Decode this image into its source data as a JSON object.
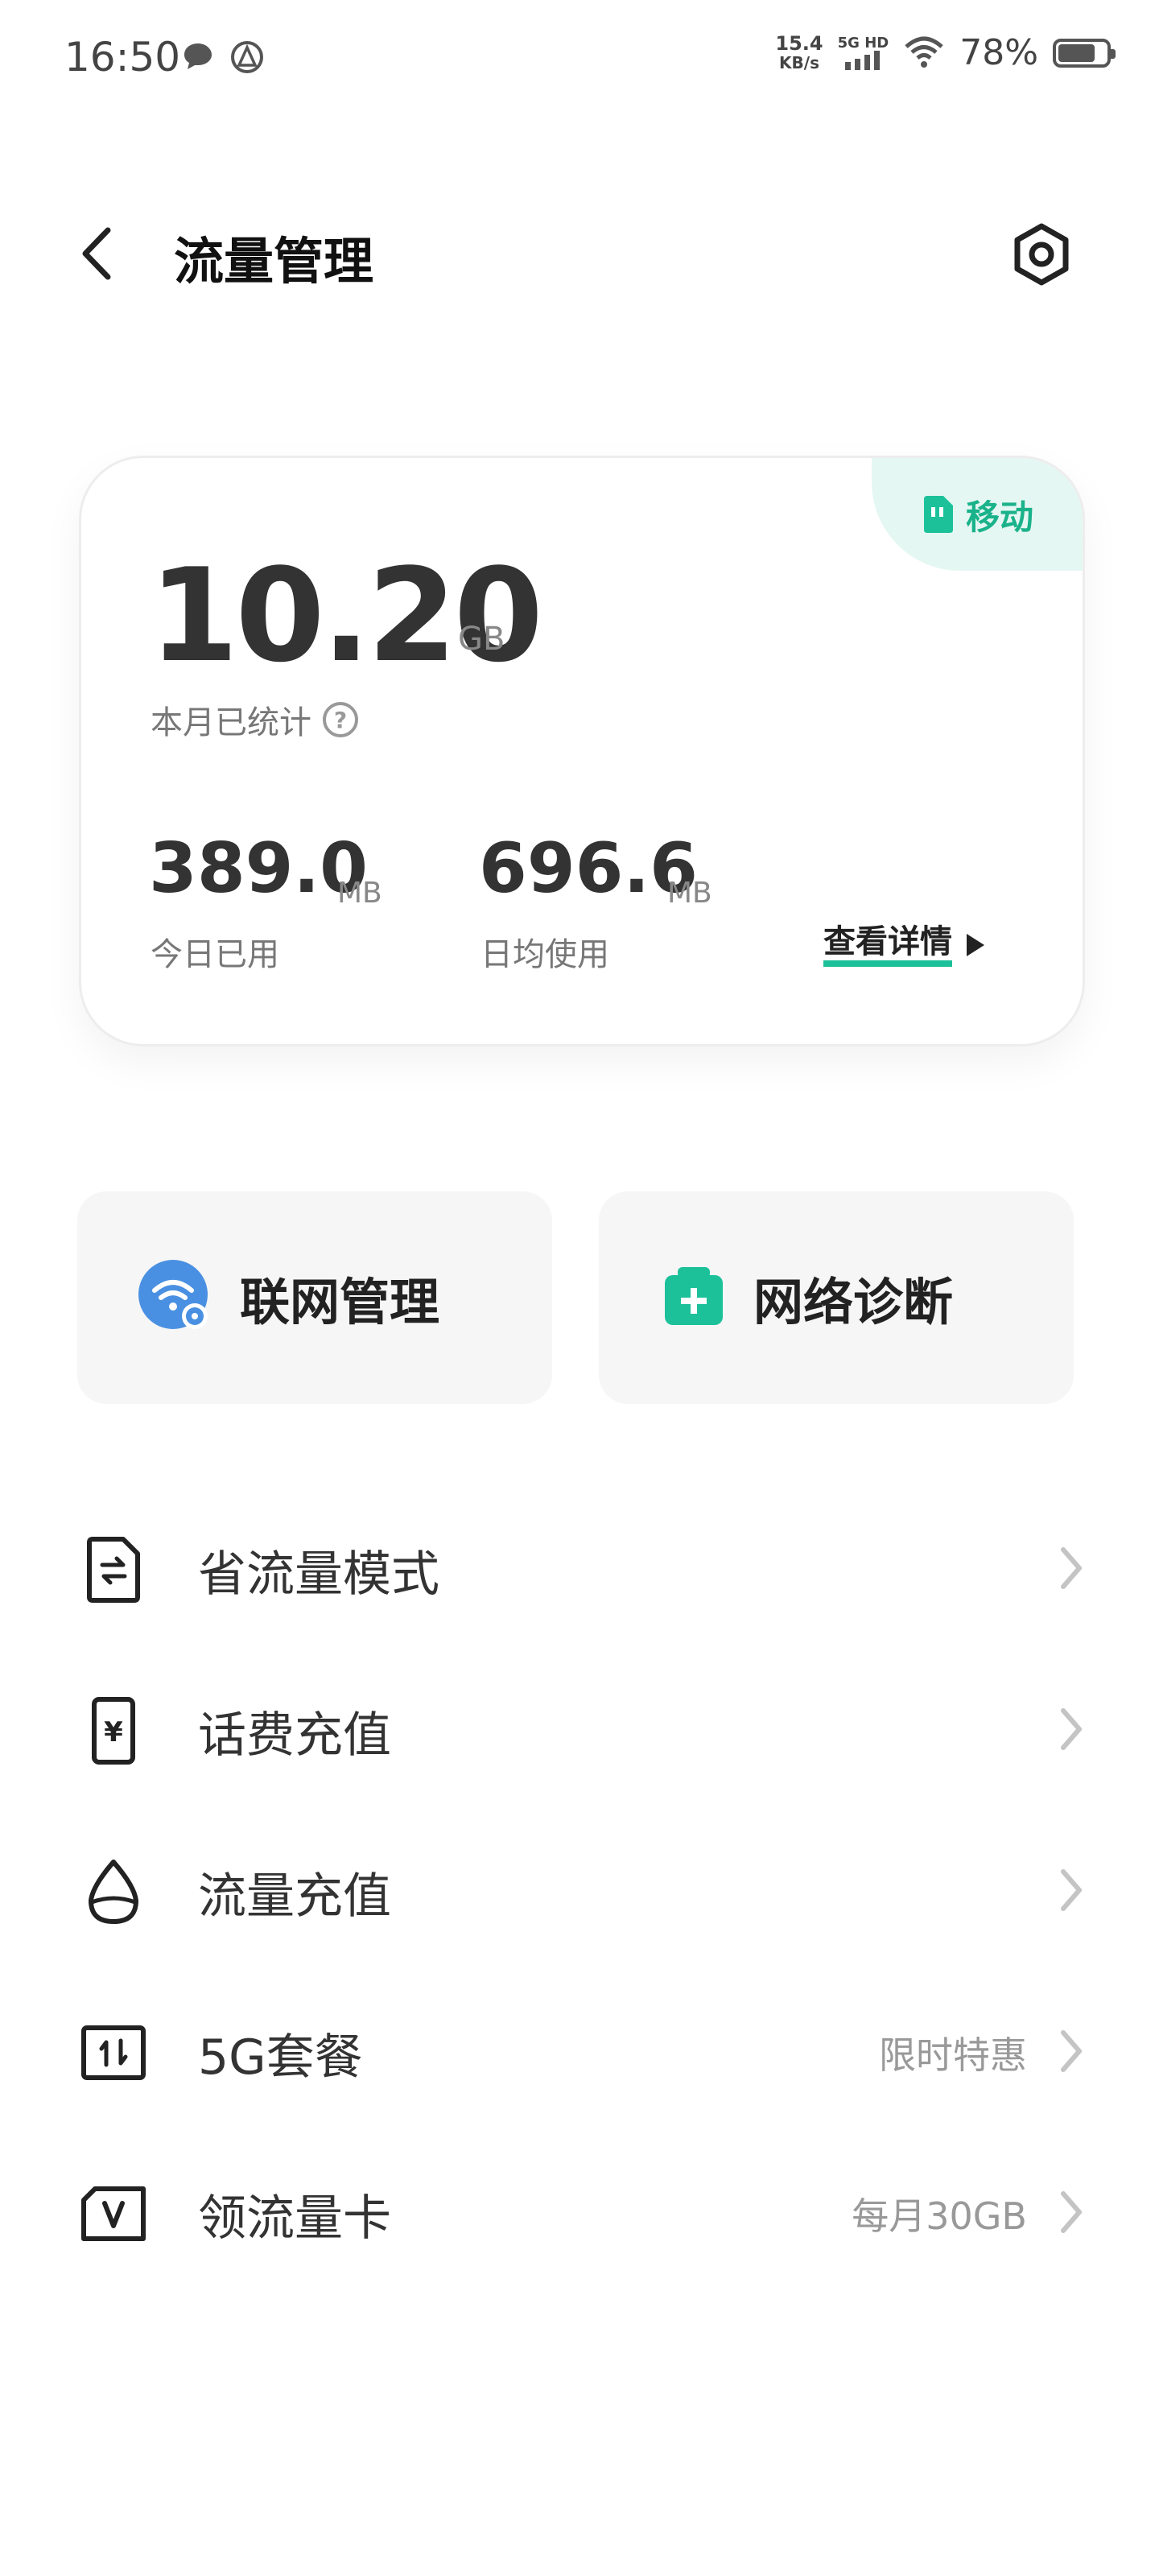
{
  "status_bar": {
    "time": "16:50",
    "speed_value": "15.4",
    "speed_unit": "KB/s",
    "network": "5G HD",
    "battery": "78%",
    "battery_level": 0.78
  },
  "header": {
    "title": "流量管理"
  },
  "usage_card": {
    "carrier": "移动",
    "month_total_value": "10.20",
    "month_total_unit": "GB",
    "month_label": "本月已统计",
    "today_value": "389.0",
    "today_unit": "MB",
    "today_label": "今日已用",
    "daily_avg_value": "696.6",
    "daily_avg_unit": "MB",
    "daily_avg_label": "日均使用",
    "details_link": "查看详情"
  },
  "quick_actions": [
    {
      "label": "联网管理",
      "icon": "wifi-icon"
    },
    {
      "label": "网络诊断",
      "icon": "medical-kit-icon"
    }
  ],
  "menu": [
    {
      "label": "省流量模式",
      "sub": "",
      "icon": "data-saver-icon"
    },
    {
      "label": "话费充值",
      "sub": "",
      "icon": "yuan-phone-icon"
    },
    {
      "label": "流量充值",
      "sub": "",
      "icon": "drop-icon"
    },
    {
      "label": "5G套餐",
      "sub": "限时特惠",
      "icon": "transfer-box-icon"
    },
    {
      "label": "领流量卡",
      "sub": "每月30GB",
      "icon": "v-card-icon"
    }
  ],
  "colors": {
    "accent": "#1cc19a",
    "wifi_blue": "#4a90e2"
  }
}
